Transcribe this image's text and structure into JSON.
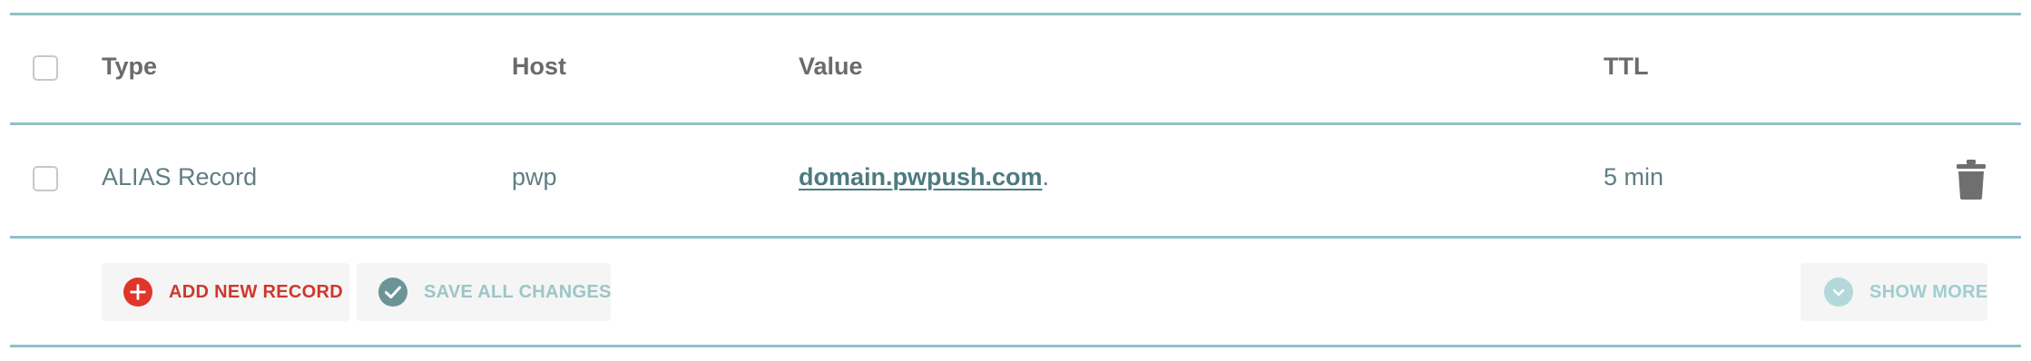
{
  "table": {
    "headers": {
      "type": "Type",
      "host": "Host",
      "value": "Value",
      "ttl": "TTL"
    },
    "rows": [
      {
        "type": "ALIAS Record",
        "host": "pwp",
        "value_link": "domain.pwpush.com",
        "value_suffix": ".",
        "ttl": "5 min",
        "delete_icon": "trash-icon"
      }
    ]
  },
  "actions": {
    "add_label": "ADD NEW RECORD",
    "save_label": "SAVE ALL CHANGES",
    "show_more_label": "SHOW MORE"
  },
  "colors": {
    "rule": "#8cc3c7",
    "add_red": "#d0372b",
    "save_teal": "#6c9497",
    "muted_teal": "#9dc5c7",
    "header_text": "#6b6b6b",
    "cell_text": "#5f7d83"
  }
}
